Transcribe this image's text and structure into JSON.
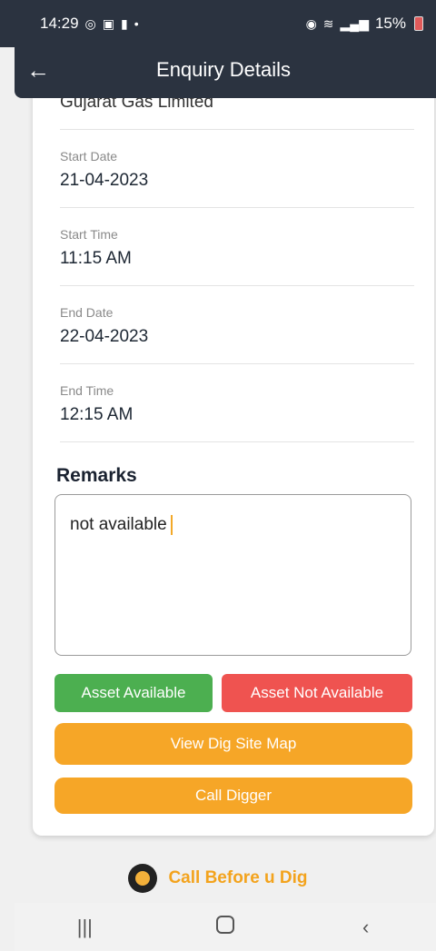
{
  "status_bar": {
    "time": "14:29",
    "left_icons": [
      "whatsapp-icon",
      "message-icon",
      "lock-icon",
      "dot-icon"
    ],
    "right_icons": [
      "alarm-icon",
      "wifi-icon",
      "signal-icon"
    ],
    "battery": "15%"
  },
  "app_bar": {
    "title": "Enquiry Details"
  },
  "details": {
    "company": "Gujarat Gas Limited",
    "fields": [
      {
        "label": "Start Date",
        "value": "21-04-2023"
      },
      {
        "label": "Start Time",
        "value": "11:15 AM"
      },
      {
        "label": "End Date",
        "value": "22-04-2023"
      },
      {
        "label": "End Time",
        "value": "12:15 AM"
      }
    ]
  },
  "remarks": {
    "heading": "Remarks",
    "value": "not available"
  },
  "buttons": {
    "asset_available": "Asset Available",
    "asset_not_available": "Asset Not Available",
    "view_map": "View Dig Site Map",
    "call_digger": "Call Digger"
  },
  "colors": {
    "app_bar": "#2b3340",
    "available": "#4caf50",
    "not_available": "#ef5350",
    "accent": "#f6a627"
  },
  "brand": {
    "text": "Call Before u Dig"
  }
}
